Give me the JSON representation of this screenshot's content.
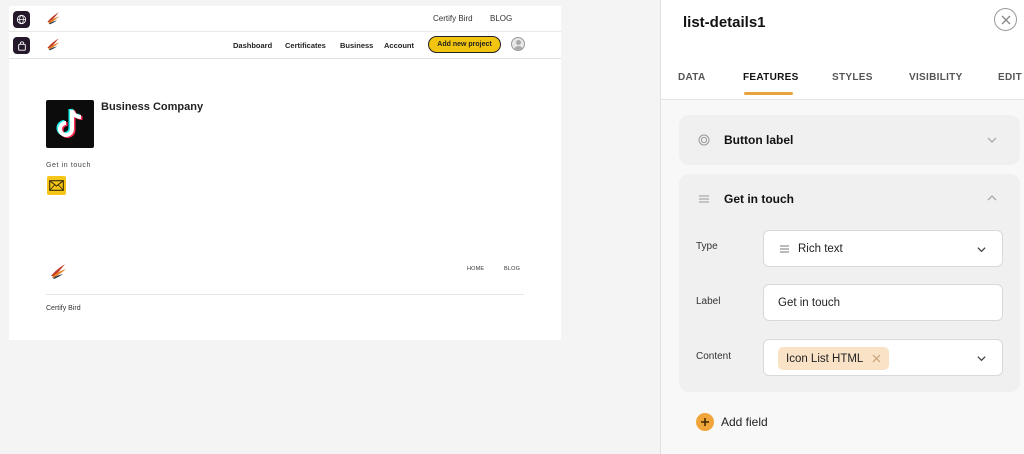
{
  "preview": {
    "top_nav": {
      "links": [
        "Certify Bird",
        "BLOG"
      ]
    },
    "main_nav": {
      "links": [
        "Dashboard",
        "Certificates",
        "Business",
        "Account"
      ],
      "cta_label": "Add new project"
    },
    "company_name": "Business Company",
    "get_in_touch_label": "Get in touch",
    "footer": {
      "links": [
        "HOME",
        "BLOG"
      ],
      "copyright": "Certify Bird"
    }
  },
  "panel": {
    "title": "list-details1",
    "tabs": [
      "DATA",
      "FEATURES",
      "STYLES",
      "VISIBILITY",
      "EDIT"
    ],
    "active_tab": "FEATURES",
    "sections": [
      {
        "title": "Button label",
        "expanded": false
      },
      {
        "title": "Get in touch",
        "expanded": true,
        "fields": {
          "type": {
            "label": "Type",
            "value": "Rich text"
          },
          "label": {
            "label": "Label",
            "value": "Get in touch"
          },
          "content": {
            "label": "Content",
            "chip": "Icon List HTML"
          }
        }
      }
    ],
    "add_field_label": "Add field"
  },
  "colors": {
    "accent": "#e8a33d",
    "cta_yellow": "#f1c40f",
    "chip_bg": "#f9e2c6",
    "dark_icon_bg": "#24182a"
  }
}
